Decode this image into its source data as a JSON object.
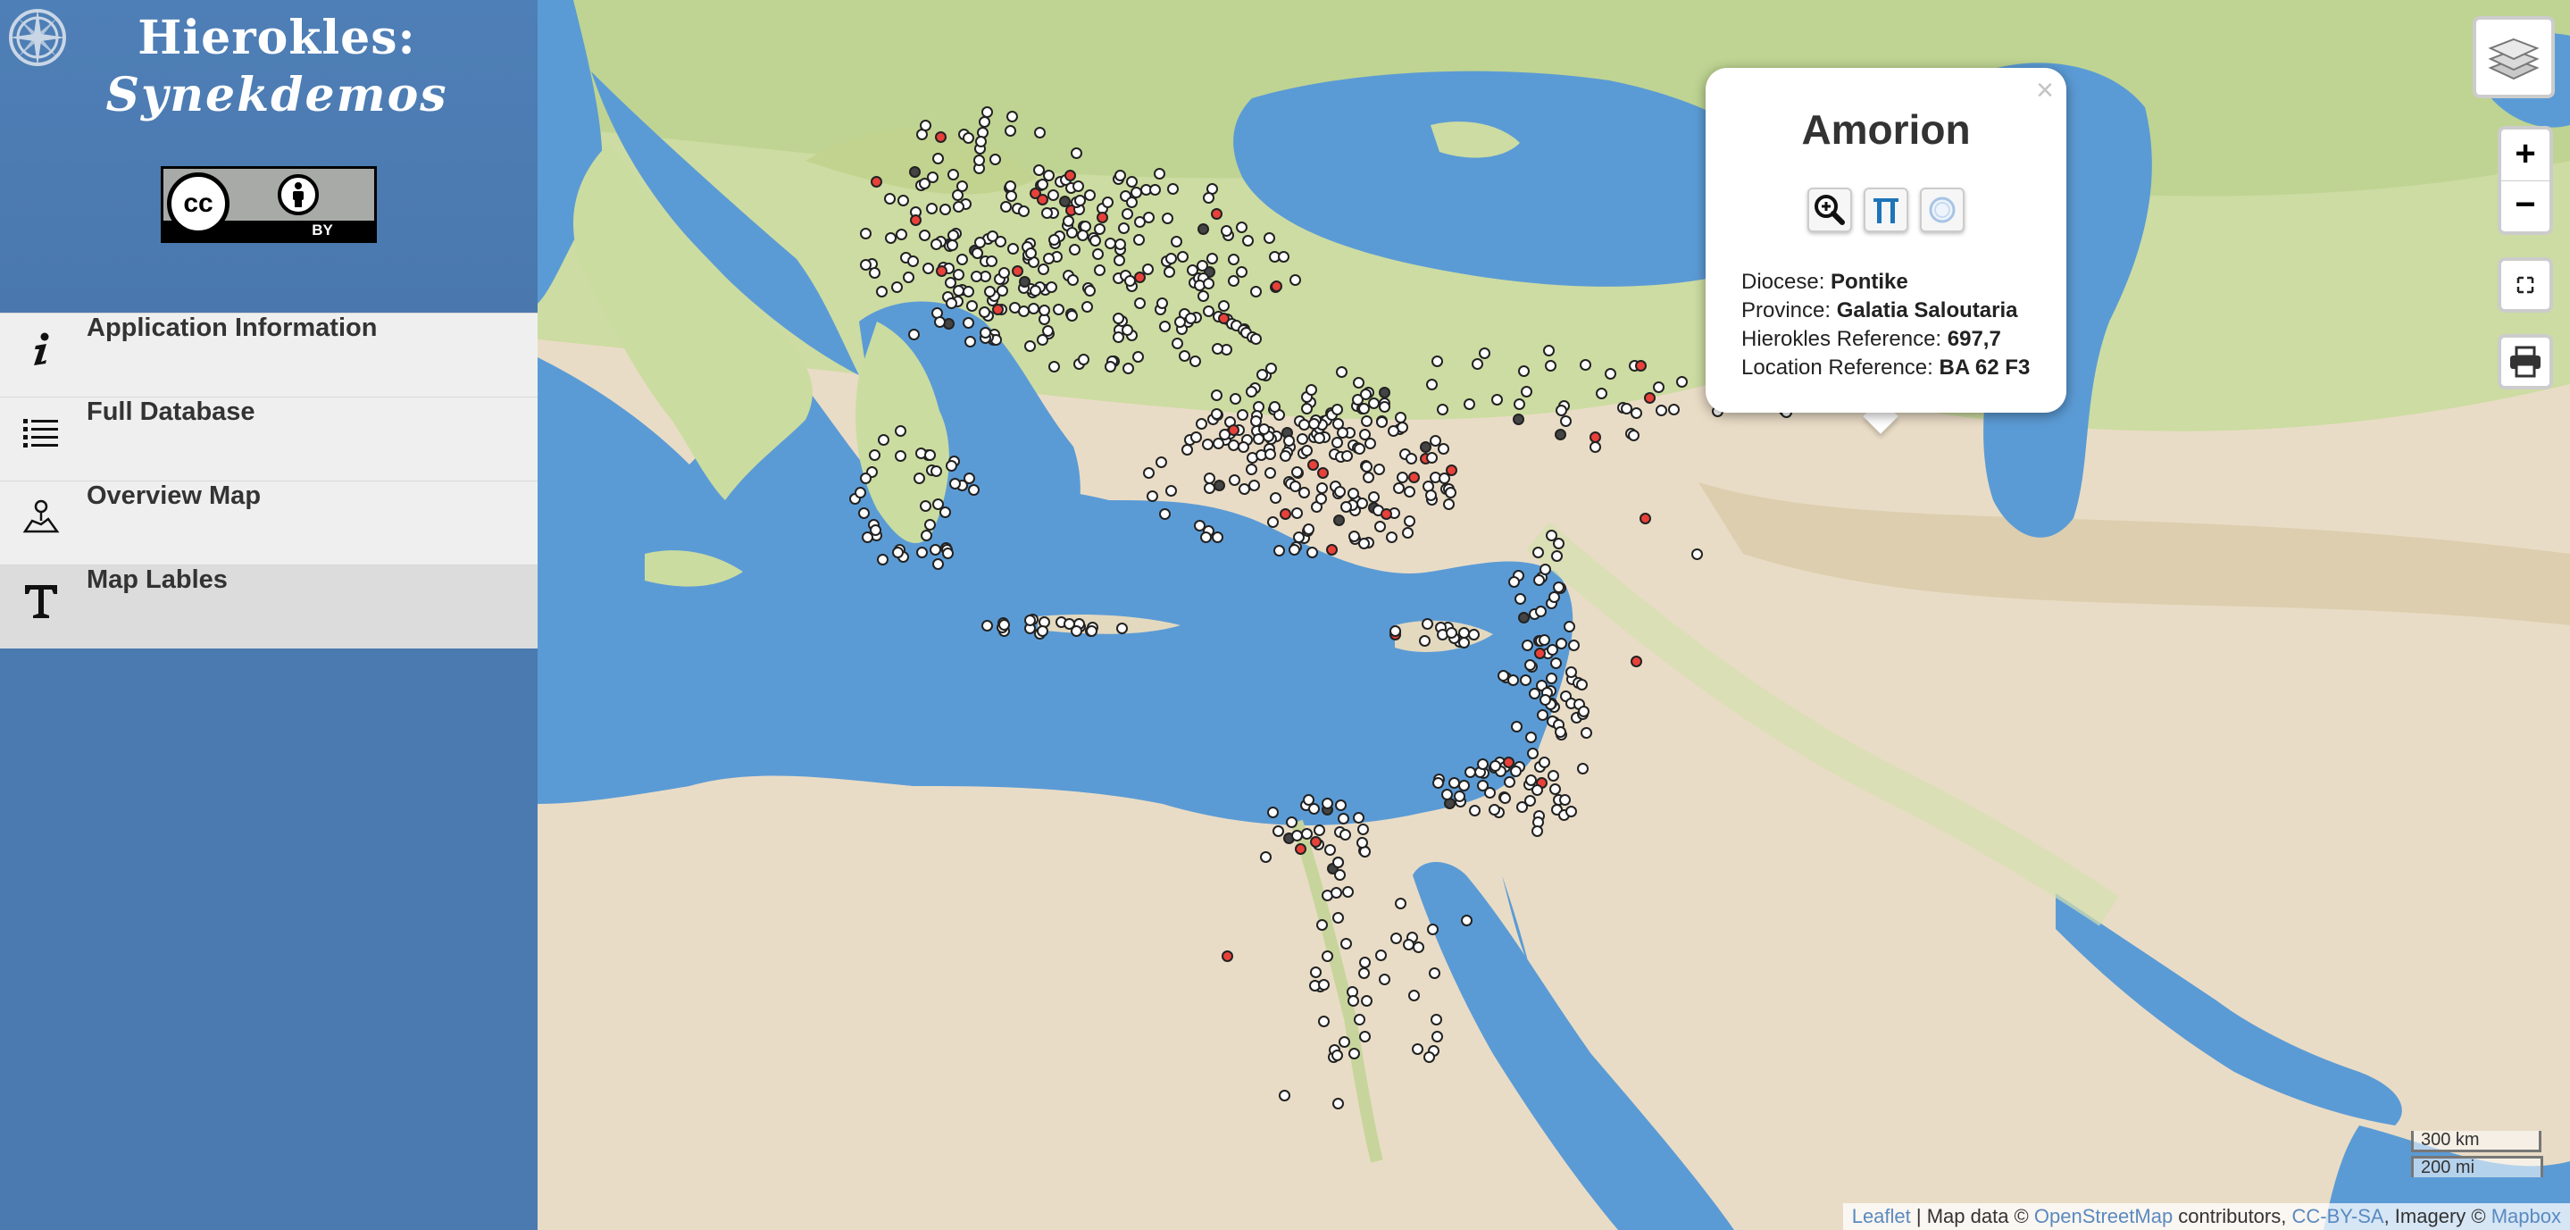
{
  "sidebar": {
    "title_line1": "Hierokles:",
    "title_line2": "Synekdemos",
    "license_badge": {
      "cc": "cc",
      "by": "BY"
    },
    "menu": [
      {
        "label": "Application Information",
        "icon": "info-icon"
      },
      {
        "label": "Full Database",
        "icon": "list-icon"
      },
      {
        "label": "Overview Map",
        "icon": "map-icon"
      },
      {
        "label": "Map Lables",
        "icon": "text-icon"
      }
    ],
    "collapse_icon": "triangle-left-icon"
  },
  "popup": {
    "title": "Amorion",
    "close": "×",
    "buttons": [
      "zoom-in-icon",
      "pleiades-icon",
      "circle-icon"
    ],
    "rows": [
      {
        "label": "Diocese: ",
        "value": "Pontike"
      },
      {
        "label": "Province: ",
        "value": "Galatia Saloutaria"
      },
      {
        "label": "Hierokles Reference: ",
        "value": "697,7"
      },
      {
        "label": "Location Reference: ",
        "value": "BA 62 F3"
      }
    ]
  },
  "controls": {
    "zoom_in": "+",
    "zoom_out": "−",
    "layers_icon": "layers-icon",
    "fullscreen_icon": "fullscreen-icon",
    "print_icon": "printer-icon"
  },
  "scale": {
    "km": "300 km",
    "mi": "200 mi"
  },
  "attribution": {
    "leaflet": "Leaflet",
    "sep": " | Map data © ",
    "osm": "OpenStreetMap",
    "contrib": " contributors, ",
    "license": "CC-BY-SA",
    "imagery": ", Imagery © ",
    "mapbox": "Mapbox"
  },
  "colors": {
    "sidebar": "#4a7ab0",
    "sea": "#5b9bd5",
    "land_green": "#cfe0a8",
    "desert": "#ede4d4",
    "marker_default": "#ffffff",
    "marker_highlight": "#e8413a",
    "marker_dark": "#444444"
  }
}
